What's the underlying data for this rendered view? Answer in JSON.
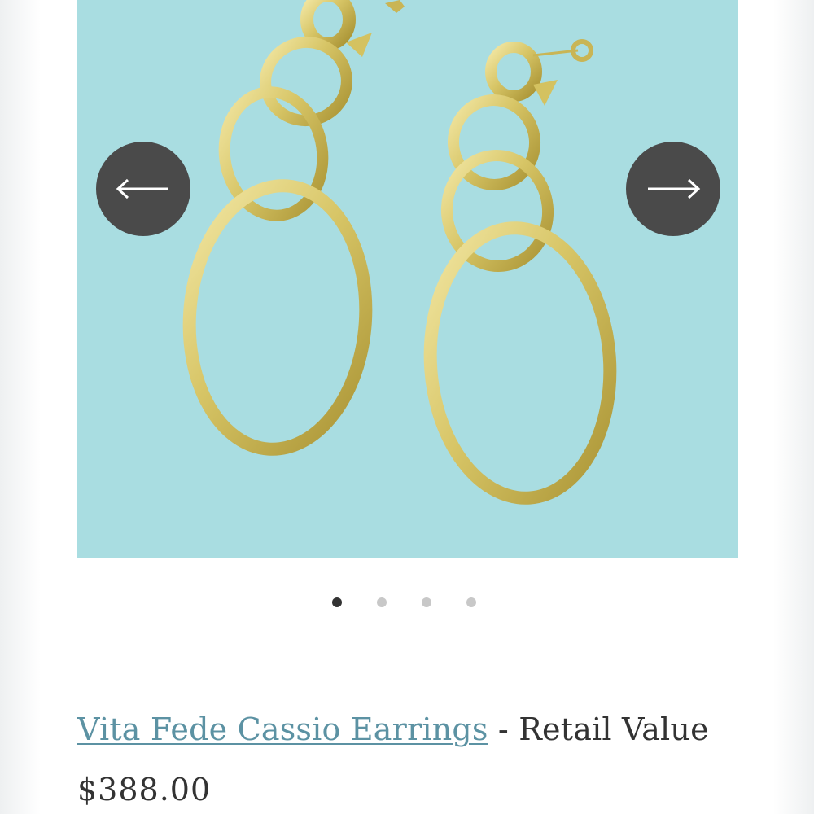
{
  "product": {
    "name": "Vita Fede Cassio Earrings",
    "title_suffix": " - Retail Value",
    "price": "$388.00"
  },
  "gallery": {
    "image_subject": "gold-chain-link-earrings",
    "background_color": "#a9dde1",
    "metal_color": "#d8c66a",
    "prev_icon": "arrow-left-icon",
    "next_icon": "arrow-right-icon",
    "slide_count": 4,
    "active_slide": 1
  },
  "colors": {
    "link": "#5c92a3",
    "text": "#333333",
    "arrow_button": "#4a4a4a",
    "dot_active": "#333333",
    "dot_inactive": "#c8c8c8"
  }
}
